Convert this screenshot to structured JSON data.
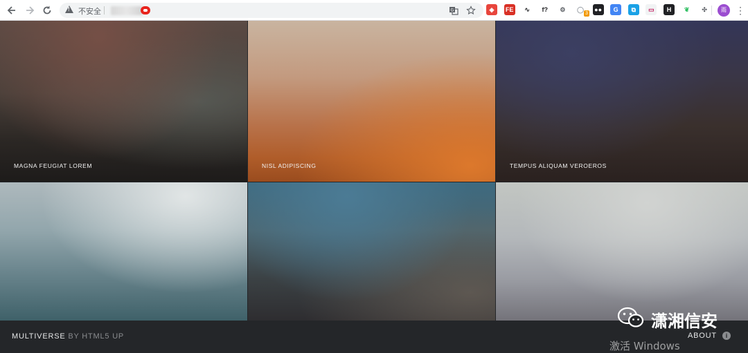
{
  "browser": {
    "back_icon": "arrow-left-icon",
    "forward_icon": "arrow-right-icon",
    "reload_icon": "reload-icon",
    "security_label": "不安全",
    "extensions": [
      {
        "name": "ext-red-icon",
        "glyph": "◈",
        "bg": "#e8453c",
        "fg": "#ffffff"
      },
      {
        "name": "ext-fe-icon",
        "glyph": "FE",
        "bg": "#d93025",
        "fg": "#ffffff"
      },
      {
        "name": "ext-curl-icon",
        "glyph": "∿",
        "bg": "#ffffff",
        "fg": "#202124"
      },
      {
        "name": "ext-f-icon",
        "glyph": "f?",
        "bg": "#ffffff",
        "fg": "#202124"
      },
      {
        "name": "ext-gear-icon",
        "glyph": "⚙",
        "bg": "#ffffff",
        "fg": "#5f6368"
      },
      {
        "name": "ext-search-badge-icon",
        "glyph": "◯",
        "bg": "#ffffff",
        "fg": "#9aa0a6"
      },
      {
        "name": "ext-tampermonkey-icon",
        "glyph": "●●",
        "bg": "#202124",
        "fg": "#ffffff"
      },
      {
        "name": "ext-translate-icon",
        "glyph": "G",
        "bg": "#4285f4",
        "fg": "#ffffff"
      },
      {
        "name": "ext-screenshot-icon",
        "glyph": "⧉",
        "bg": "#1aa1e6",
        "fg": "#ffffff"
      },
      {
        "name": "ext-window-icon",
        "glyph": "▭",
        "bg": "#f1f3f4",
        "fg": "#c2185b"
      },
      {
        "name": "ext-h-icon",
        "glyph": "H",
        "bg": "#202124",
        "fg": "#ffffff"
      },
      {
        "name": "ext-evernote-icon",
        "glyph": "❦",
        "bg": "#ffffff",
        "fg": "#2dbe60"
      },
      {
        "name": "extensions-puzzle-icon",
        "glyph": "✣",
        "bg": "#ffffff",
        "fg": "#5f6368"
      }
    ],
    "extension_badge": "3",
    "avatar_label": "雨"
  },
  "gallery": {
    "tiles": [
      {
        "caption": "MAGNA FEUGIAT LOREM"
      },
      {
        "caption": "NISL ADIPISCING"
      },
      {
        "caption": "TEMPUS ALIQUAM VEROEROS"
      },
      {
        "caption": ""
      },
      {
        "caption": ""
      },
      {
        "caption": ""
      }
    ]
  },
  "footer": {
    "brand": "MULTIVERSE",
    "brand_by": "BY HTML5 UP",
    "about_label": "ABOUT",
    "about_icon": "info-icon"
  },
  "overlay": {
    "watermark_icon": "wechat-icon",
    "watermark_text": "潇湘信安",
    "activate_text": "激活 Windows"
  }
}
